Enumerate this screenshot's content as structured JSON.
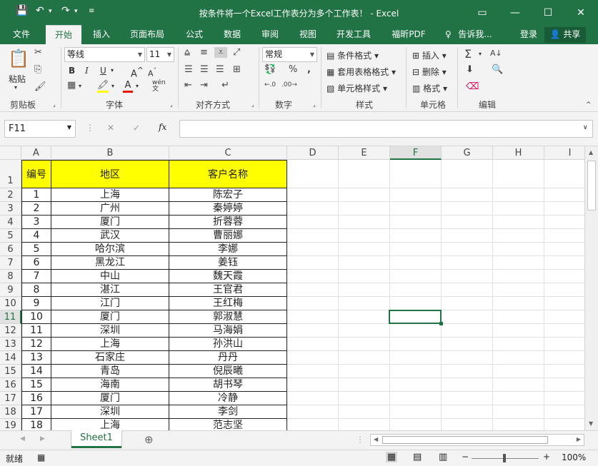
{
  "window": {
    "title": "按条件将一个Excel工作表分为多个工作表！ - Excel"
  },
  "tabs": [
    "文件",
    "开始",
    "插入",
    "页面布局",
    "公式",
    "数据",
    "审阅",
    "视图",
    "开发工具",
    "福昕PDF",
    "告诉我...",
    "登录",
    "共享"
  ],
  "ribbon": {
    "clipboard": {
      "paste": "粘贴",
      "label": "剪贴板"
    },
    "font": {
      "name": "等线",
      "size": "11",
      "label": "字体",
      "bold": "B",
      "italic": "I",
      "underline": "U",
      "phonetic": "wén"
    },
    "alignment": {
      "label": "对齐方式"
    },
    "number": {
      "format": "常规",
      "label": "数字"
    },
    "styles": {
      "conditional": "条件格式",
      "table": "套用表格格式",
      "cell": "单元格样式",
      "label": "样式"
    },
    "cells": {
      "insert": "插入",
      "delete": "删除",
      "format": "格式",
      "label": "单元格"
    },
    "editing": {
      "label": "编辑"
    }
  },
  "formula_bar": {
    "name_box": "F11",
    "fx": "fx",
    "value": ""
  },
  "columns": [
    "A",
    "B",
    "C",
    "D",
    "E",
    "F",
    "G",
    "H",
    "I"
  ],
  "table": {
    "header": [
      "编号",
      "地区",
      "客户名称"
    ],
    "rows": [
      [
        "1",
        "上海",
        "陈宏子"
      ],
      [
        "2",
        "广州",
        "秦婷婷"
      ],
      [
        "3",
        "厦门",
        "折蓉蓉"
      ],
      [
        "4",
        "武汉",
        "曹丽娜"
      ],
      [
        "5",
        "哈尔滨",
        "李娜"
      ],
      [
        "6",
        "黑龙江",
        "姜钰"
      ],
      [
        "7",
        "中山",
        "魏天霞"
      ],
      [
        "8",
        "湛江",
        "王官君"
      ],
      [
        "9",
        "江门",
        "王红梅"
      ],
      [
        "10",
        "厦门",
        "郭淑慧"
      ],
      [
        "11",
        "深圳",
        "马海娟"
      ],
      [
        "12",
        "上海",
        "孙洪山"
      ],
      [
        "13",
        "石家庄",
        "丹丹"
      ],
      [
        "14",
        "青岛",
        "倪辰曦"
      ],
      [
        "15",
        "海南",
        "胡书琴"
      ],
      [
        "16",
        "厦门",
        "冷静"
      ],
      [
        "17",
        "深圳",
        "李剑"
      ],
      [
        "18",
        "上海",
        "范志坚"
      ]
    ]
  },
  "row_numbers": [
    "1",
    "2",
    "3",
    "4",
    "5",
    "6",
    "7",
    "8",
    "9",
    "10",
    "11",
    "12",
    "13",
    "14",
    "15",
    "16",
    "17",
    "18",
    "19"
  ],
  "sheet": {
    "name": "Sheet1"
  },
  "status": {
    "ready": "就绪",
    "zoom": "100%"
  }
}
